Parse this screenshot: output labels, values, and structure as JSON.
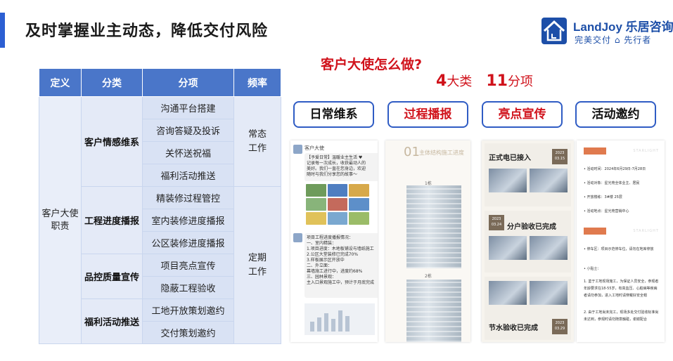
{
  "title": "及时掌握业主动态，降低交付风险",
  "logo": {
    "name": "LandJoy 乐居咨询",
    "tagline": "完美交付 ⌂ 先行者",
    "brand_color": "#1d4fa8"
  },
  "table": {
    "headers": [
      "定义",
      "分类",
      "分项",
      "频率"
    ],
    "definition": "客户大使\n职责",
    "groups": [
      {
        "category": "客户情感维系",
        "items": [
          "沟通平台搭建",
          "咨询答疑及投诉",
          "关怀送祝福",
          "福利活动推送"
        ]
      },
      {
        "category": "工程进度播报",
        "items": [
          "精装修过程管控",
          "室内装修进度播报",
          "公区装修进度播报"
        ]
      },
      {
        "category": "品控质量宣传",
        "items": [
          "项目亮点宣传",
          "隐蔽工程验收"
        ]
      },
      {
        "category": "福利活动推送",
        "items": [
          "工地开放策划邀约",
          "交付策划邀约"
        ]
      }
    ],
    "frequencies": [
      "常态\n工作",
      "定期\n工作"
    ]
  },
  "question": "客户大使怎么做?",
  "counts": {
    "big_num": "4",
    "big_unit": "大类",
    "sub_num": "11",
    "sub_unit": "分项"
  },
  "actions": [
    "日常维系",
    "过程播报",
    "亮点宣传",
    "活动邀约"
  ],
  "panels": {
    "chat": {
      "sender": "客户大使",
      "message1": "【予爱日常】温暖业主生活 ♥\n记录每一次成长，收获最动人的\n美好。我们一直在您身边，欢迎\n随时与我们分享您的故事～",
      "message2": "项目工程进度播报情况：\n一、室内精装：\n1.项目进度：木地板铺设与墙纸施工\n2.公区大堂装修已完成70%\n3.样板展示区开放中\n二、外立面：\n幕墙施工进行中，进度约68%\n三、园林景观：\n主入口景观施工中，预计于月底完成"
    },
    "progress": {
      "num": "01",
      "heading": "主体结构施工进度",
      "label1": "1栋",
      "label2": "2栋"
    },
    "highlight": {
      "title1": "正式电已接入",
      "title2": "分户验收已完成",
      "title3": "节水验收已完成",
      "date1": "2023\n03.15",
      "date2": "2023\n03.24",
      "date3": "2023\n03.29"
    },
    "invite": {
      "watermark": "STARLIGHT",
      "lines": [
        "• 活动时间：2024年6月29日-7月28日",
        "• 活动对象：星光苑全体业主、居民",
        "• 开放楼栋：3#楼 25层",
        "• 活动地点：星光苑营销中心"
      ],
      "tips": [
        "• 停车区：项目示范停车位，请勿在地库停放",
        "• 小贴士：",
        "1. 鉴于工地现场施工，为保证人员安全，参观者",
        "   年龄要求在18-55岁，有高血压、心脏病等疾病",
        "   者请勿参加，进入工地时请穿戴好安全帽",
        "2. 由于工地尚未完工，现场多处交付验收标准尚",
        "   未达到，参观时请勿随意触碰，谢谢配合"
      ]
    }
  },
  "colors": {
    "header": "#4a76c9",
    "accent": "#2c5fd3",
    "red": "#d0121b",
    "pill_border": "#2f5cc4"
  }
}
